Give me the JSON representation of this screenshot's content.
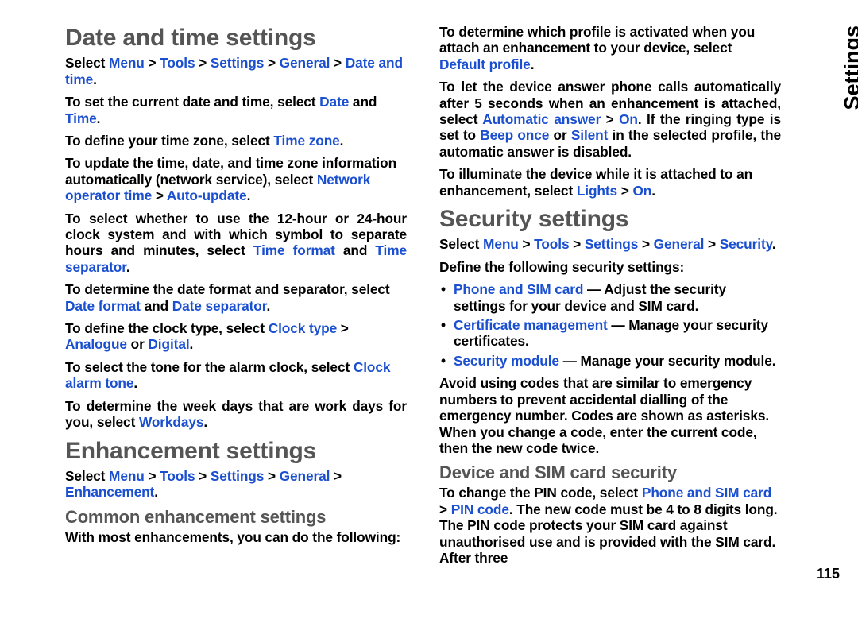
{
  "sideTab": "Settings",
  "pageNum": "115",
  "left": {
    "h1a": "Date and time settings",
    "p1a": "Select ",
    "p1b": "Menu",
    "p1c": " > ",
    "p1d": "Tools",
    "p1e": " > ",
    "p1f": "Settings",
    "p1g": " > ",
    "p1h": "General",
    "p1i": " > ",
    "p1j": "Date and time",
    "p1k": ".",
    "p2a": "To set the current date and time, select ",
    "p2b": "Date",
    "p2c": " and ",
    "p2d": "Time",
    "p2e": ".",
    "p3a": "To define your time zone, select ",
    "p3b": "Time zone",
    "p3c": ".",
    "p4a": "To update the time, date, and time zone information automatically (network service), select ",
    "p4b": "Network operator time",
    "p4c": " > ",
    "p4d": "Auto-update",
    "p4e": ".",
    "p5a": "To select whether to use the 12-hour or 24-hour clock system and with which symbol to separate hours and minutes, select ",
    "p5b": "Time format",
    "p5c": " and ",
    "p5d": "Time separator",
    "p5e": ".",
    "p6a": "To determine the date format and separator, select ",
    "p6b": "Date format",
    "p6c": " and ",
    "p6d": "Date separator",
    "p6e": ".",
    "p7a": "To define the clock type, select ",
    "p7b": "Clock type",
    "p7c": " > ",
    "p7d": "Analogue",
    "p7e": " or ",
    "p7f": "Digital",
    "p7g": ".",
    "p8a": "To select the tone for the alarm clock, select ",
    "p8b": "Clock alarm tone",
    "p8c": ".",
    "p9a": "To determine the week days that are work days for you, select ",
    "p9b": "Workdays",
    "p9c": ".",
    "h1b": "Enhancement settings",
    "p10a": "Select ",
    "p10b": "Menu",
    "p10c": " > ",
    "p10d": "Tools",
    "p10e": " > ",
    "p10f": "Settings",
    "p10g": " > ",
    "p10h": "General",
    "p10i": " > ",
    "p10j": "Enhancement",
    "p10k": ".",
    "h2a": "Common enhancement settings",
    "p11": "With most enhancements, you can do the following:"
  },
  "right": {
    "p1a": "To determine which profile is activated when you attach an enhancement to your device, select ",
    "p1b": "Default profile",
    "p1c": ".",
    "p2a": "To let the device answer phone calls automatically after 5 seconds when an enhancement is attached, select ",
    "p2b": "Automatic answer",
    "p2c": " > ",
    "p2d": "On",
    "p2e": ". If the ringing type is set to ",
    "p2f": "Beep once",
    "p2g": " or ",
    "p2h": "Silent",
    "p2i": " in the selected profile, the automatic answer is disabled.",
    "p3a": "To illuminate the device while it is attached to an enhancement, select ",
    "p3b": "Lights",
    "p3c": " > ",
    "p3d": "On",
    "p3e": ".",
    "h1a": "Security settings",
    "p4a": "Select ",
    "p4b": "Menu",
    "p4c": " > ",
    "p4d": "Tools",
    "p4e": " > ",
    "p4f": "Settings",
    "p4g": " > ",
    "p4h": "General",
    "p4i": " > ",
    "p4j": "Security",
    "p4k": ".",
    "p5": "Define the following security settings:",
    "li1a": "Phone and SIM card",
    "li1b": " — Adjust the security settings for your device and SIM card.",
    "li2a": "Certificate management",
    "li2b": " — Manage your security certificates.",
    "li3a": "Security module",
    "li3b": " — Manage your security module.",
    "p6": "Avoid using codes that are similar to emergency numbers to prevent accidental dialling of the emergency number. Codes are shown as asterisks. When you change a code, enter the current code, then the new code twice.",
    "h2a": "Device and SIM card security",
    "p7a": "To change the PIN code, select ",
    "p7b": "Phone and SIM card",
    "p7c": " > ",
    "p7d": "PIN code",
    "p7e": ". The new code must be 4 to 8 digits long. The PIN code protects your SIM card against unauthorised use and is provided with the SIM card. After three"
  }
}
